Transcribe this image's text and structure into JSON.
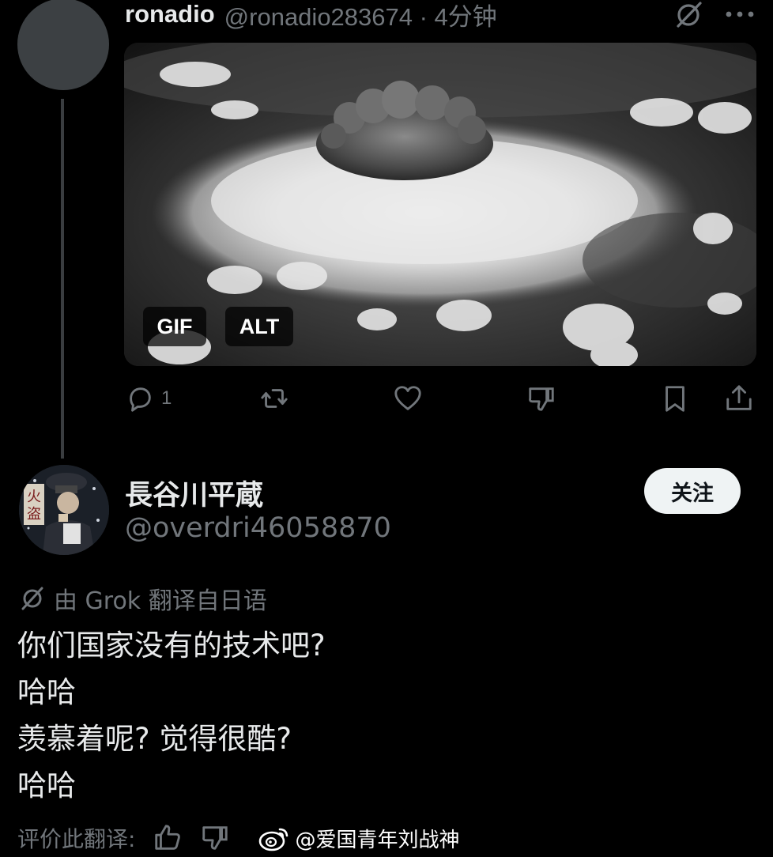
{
  "tweet1": {
    "display_name": "ronadio",
    "handle_time": "@ronadio283674 · 4分钟",
    "media_badges": {
      "gif": "GIF",
      "alt": "ALT"
    },
    "reply_count": "1",
    "icons": [
      "grok-icon",
      "more-icon",
      "reply-icon",
      "retweet-icon",
      "like-icon",
      "dislike-icon",
      "bookmark-icon",
      "share-icon"
    ]
  },
  "tweet2": {
    "display_name": "長谷川平蔵",
    "handle": "@overdri46058870",
    "follow_label": "关注",
    "translated_by": "由 Grok 翻译自日语",
    "body_lines": [
      "你们国家没有的技术吧?",
      "哈哈",
      "羡慕着呢? 觉得很酷?",
      "哈哈"
    ],
    "rate_translation_label": "评价此翻译:",
    "watermark": "@爱国青年刘战神"
  },
  "colors": {
    "background": "#000000",
    "text_primary": "#e7e9ea",
    "text_secondary": "#71767b",
    "button_bg": "#eff3f4"
  }
}
